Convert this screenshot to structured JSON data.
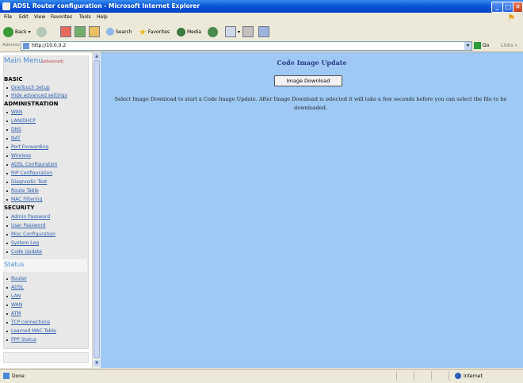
{
  "window": {
    "title": "ADSL Router configuration - Microsoft Internet Explorer",
    "minimize": "_",
    "maximize": "□",
    "close": "✕"
  },
  "menubar": [
    "File",
    "Edit",
    "View",
    "Favorites",
    "Tools",
    "Help"
  ],
  "toolbar": {
    "back": "Back",
    "search": "Search",
    "favorites": "Favorites",
    "media": "Media"
  },
  "address": {
    "label": "Address",
    "url": "http://10.0.0.2",
    "go": "Go",
    "links": "Links"
  },
  "sidebar": {
    "title": "Main Menu",
    "tag": "(advanced)",
    "basic": {
      "heading": "BASIC",
      "items": [
        "OneTouch Setup",
        "Hide advanced settings"
      ]
    },
    "administration": {
      "heading": "ADMINISTRATION",
      "items": [
        "WAN",
        "LAN/DHCP",
        "DNS",
        "NAT",
        "Port Forwarding",
        "Wireless",
        "ADSL Configuration",
        "RIP Configuration",
        "Diagnostic Test",
        "Route Table",
        "MAC Filtering"
      ]
    },
    "security": {
      "heading": "SECURITY",
      "items": [
        "Admin Password",
        "User Password",
        "Misc Configuration",
        "System Log",
        "Code Update"
      ]
    },
    "status": {
      "title": "Status",
      "items": [
        "Router",
        "ADSL",
        "LAN",
        "WAN",
        "ATM",
        "TCP connections",
        "Learned MAC Table",
        "PPP Status"
      ]
    }
  },
  "content": {
    "heading": "Code Image Update",
    "button_label": "Image Download",
    "description": "Select Image Download to start a Code Image Update. After Image Download is selected it will take a few seconds before you can select the file to be downloaded."
  },
  "statusbar": {
    "status": "Done",
    "zone": "Internet"
  },
  "colors": {
    "content_bg": "#9ec9f5",
    "heading": "#2c3a88",
    "link": "#3060b0",
    "menu_title": "#4a8fd8"
  }
}
